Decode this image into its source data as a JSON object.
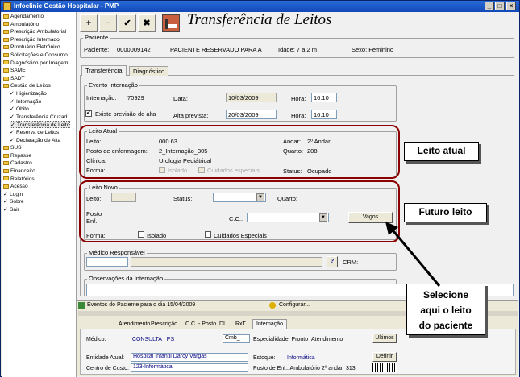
{
  "window": {
    "title": "Infoclinic Gestão Hospitalar - PMP",
    "min": "_",
    "max": "□",
    "close": "×"
  },
  "tree": [
    {
      "label": "Agendamento",
      "kind": "folder",
      "lvl": 0
    },
    {
      "label": "Ambulatório",
      "kind": "folder",
      "lvl": 0
    },
    {
      "label": "Prescrição Ambulatorial",
      "kind": "folder",
      "lvl": 0
    },
    {
      "label": "Prescrição Internado",
      "kind": "folder",
      "lvl": 0
    },
    {
      "label": "Prontuário Eletrônico",
      "kind": "folder",
      "lvl": 0
    },
    {
      "label": "Solicitações e Consumo",
      "kind": "folder",
      "lvl": 0
    },
    {
      "label": "Diagnóstico por Imagem",
      "kind": "folder",
      "lvl": 0
    },
    {
      "label": "SAME",
      "kind": "folder",
      "lvl": 0
    },
    {
      "label": "SADT",
      "kind": "folder",
      "lvl": 0
    },
    {
      "label": "Gestão de Leitos",
      "kind": "folder",
      "lvl": 0
    },
    {
      "label": "Higienização",
      "kind": "check",
      "lvl": 1
    },
    {
      "label": "Internação",
      "kind": "check",
      "lvl": 1
    },
    {
      "label": "Óbito",
      "kind": "check",
      "lvl": 1
    },
    {
      "label": "Transferência Cruzad",
      "kind": "check",
      "lvl": 1
    },
    {
      "label": "Transferência de Leito",
      "kind": "check",
      "lvl": 1,
      "selected": true
    },
    {
      "label": "Reserva de Leitos",
      "kind": "check",
      "lvl": 1
    },
    {
      "label": "Declaração de Alta",
      "kind": "check",
      "lvl": 1
    },
    {
      "label": "SUS",
      "kind": "folder",
      "lvl": 0
    },
    {
      "label": "Repasse",
      "kind": "folder",
      "lvl": 0
    },
    {
      "label": "Cadastro",
      "kind": "folder",
      "lvl": 0
    },
    {
      "label": "Financeiro",
      "kind": "folder",
      "lvl": 0
    },
    {
      "label": "Relatórios",
      "kind": "folder",
      "lvl": 0
    },
    {
      "label": "Acesso",
      "kind": "folder",
      "lvl": 0
    },
    {
      "label": "Login",
      "kind": "check",
      "lvl": 0
    },
    {
      "label": "Sobre",
      "kind": "check",
      "lvl": 0
    },
    {
      "label": "Sair",
      "kind": "check",
      "lvl": 0
    }
  ],
  "toolbar": {
    "add": "+",
    "remove": "−",
    "confirm": "✔",
    "cancel": "✖",
    "title": "Transferência de Leitos"
  },
  "paciente": {
    "legend": "Paciente",
    "label": "Paciente:",
    "code": "0000009142",
    "name": "PACIENTE RESERVADO PARA A",
    "idade": "Idade: 7 a 2 m",
    "sexo": "Sexo: Feminino"
  },
  "tabs": {
    "transferencia": "Transferência",
    "diagnostico": "Diagnóstico"
  },
  "evento": {
    "legend": "Evento Internação",
    "internacao_label": "Internação:",
    "internacao": "70929",
    "data_label": "Data:",
    "data": "10/03/2009",
    "hora_label": "Hora:",
    "hora": "16:10",
    "prev_label": "Existe previsão de alta",
    "prev_check": "✔",
    "alta_label": "Alta prevista:",
    "alta": "20/03/2009",
    "hora2": "16:10"
  },
  "atual": {
    "legend": "Leito Atual",
    "leito_label": "Leito:",
    "leito": "000.63",
    "andar_label": "Andar:",
    "andar": "2º Andar",
    "posto_label": "Posto de enfermagem:",
    "posto": "2_Internação_305",
    "quarto_label": "Quarto:",
    "quarto": "208",
    "clinica_label": "Clínica:",
    "clinica": "Urologia Pediátrical",
    "forma_label": "Forma:",
    "isolado": "Isolado",
    "cuidados": "Cuidados especiais",
    "status_label": "Status:",
    "status": "Ocupado"
  },
  "novo": {
    "legend": "Leito Novo",
    "leito_label": "Leito:",
    "status_label": "Status:",
    "quarto_label": "Quarto:",
    "posto_label1": "Posto",
    "posto_label2": "Enf.:",
    "cc_label": "C.C.:",
    "vagos": "Vagos",
    "forma_label": "Forma:",
    "isolado": "Isolado",
    "cuidados": "Cuidados Especiais",
    "dd": "▼"
  },
  "medico": {
    "legend": "Médico Responsável",
    "help": "?",
    "crm": "CRM:"
  },
  "obs": {
    "legend": "Observações da Internação"
  },
  "bottom": {
    "eventos": "Eventos do Paciente para o dia 15/04/2009",
    "config": "Configurar...",
    "tabs": [
      "Atendimento",
      "Prescrição",
      "C.C. - Posto",
      "DI",
      "RxT",
      "Internação"
    ],
    "medico_label": "Médico:",
    "medico": "_CONSULTA_ PS",
    "cmb": "Cmb_",
    "especialidade": "Especialidade: Pronto_Atendimento",
    "ultimos": "Últimos",
    "entidade_label": "Entidade Atual:",
    "entidade": "Hospital Infantil Darcy Vargas",
    "estoque_label": "Estoque:",
    "estoque": "Informática",
    "definir": "Definir",
    "cc_label": "Centro de Custo:",
    "cc": "123-Informática",
    "posto": "Posto de Enf.: Ambulatório 2º andar_313"
  },
  "callouts": {
    "atual": "Leito atual",
    "futuro": "Futuro leito",
    "select1": "Selecione",
    "select2": "aqui o leito",
    "select3": "do paciente"
  },
  "colors": {
    "titlebar": "#1148b8",
    "annotation": "#8b0000",
    "link": "#000080"
  }
}
